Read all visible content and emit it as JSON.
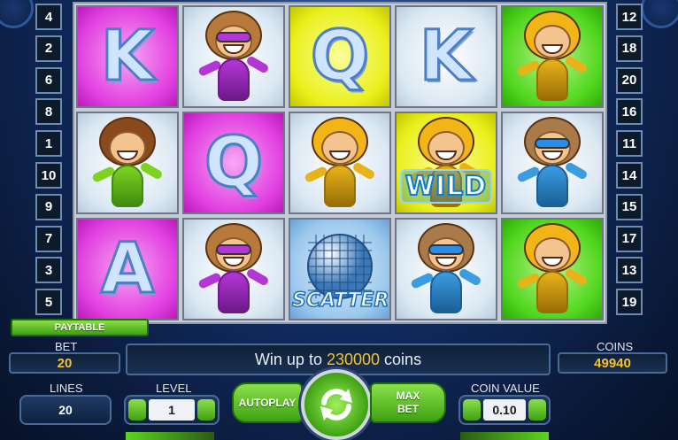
{
  "reels": [
    [
      {
        "symbol": "K",
        "bg": "magenta"
      },
      {
        "symbol": "girl-green-dancer",
        "bg": "white"
      },
      {
        "symbol": "A",
        "bg": "magenta"
      }
    ],
    [
      {
        "symbol": "purple-sunglasses-dancer",
        "bg": "white"
      },
      {
        "symbol": "Q",
        "bg": "magenta"
      },
      {
        "symbol": "purple-sunglasses-dancer",
        "bg": "white"
      }
    ],
    [
      {
        "symbol": "Q",
        "bg": "yellow"
      },
      {
        "symbol": "blond-yellow-dancer",
        "bg": "white"
      },
      {
        "symbol": "disco-ball",
        "bg": "blue",
        "label": "SCATTER"
      }
    ],
    [
      {
        "symbol": "K",
        "bg": "white"
      },
      {
        "symbol": "blond-yellow-dancer",
        "bg": "yellow",
        "label": "WILD"
      },
      {
        "symbol": "star-glasses-dancer",
        "bg": "white"
      }
    ],
    [
      {
        "symbol": "blond-yellow-dancer",
        "bg": "green"
      },
      {
        "symbol": "star-glasses-dancer",
        "bg": "white"
      },
      {
        "symbol": "blond-yellow-dancer",
        "bg": "green"
      }
    ]
  ],
  "paylines_left": [
    "4",
    "2",
    "6",
    "8",
    "1",
    "10",
    "9",
    "7",
    "3",
    "5"
  ],
  "paylines_right": [
    "12",
    "18",
    "20",
    "16",
    "11",
    "14",
    "15",
    "17",
    "13",
    "19"
  ],
  "paytable_label": "PAYTABLE",
  "bet": {
    "label": "BET",
    "value": "20"
  },
  "coins": {
    "label": "COINS",
    "value": "49940"
  },
  "message": {
    "prefix": "Win up to ",
    "amount": "230000",
    "suffix": " coins"
  },
  "lines": {
    "label": "LINES",
    "value": "20"
  },
  "level": {
    "label": "LEVEL",
    "value": "1"
  },
  "coin_value": {
    "label": "COIN VALUE",
    "value": "0.10"
  },
  "autoplay_label": "AUTOPLAY",
  "maxbet_label": "MAX\nBET",
  "colors": {
    "accent_gold": "#f4c130",
    "button_green": "#3ea112"
  }
}
